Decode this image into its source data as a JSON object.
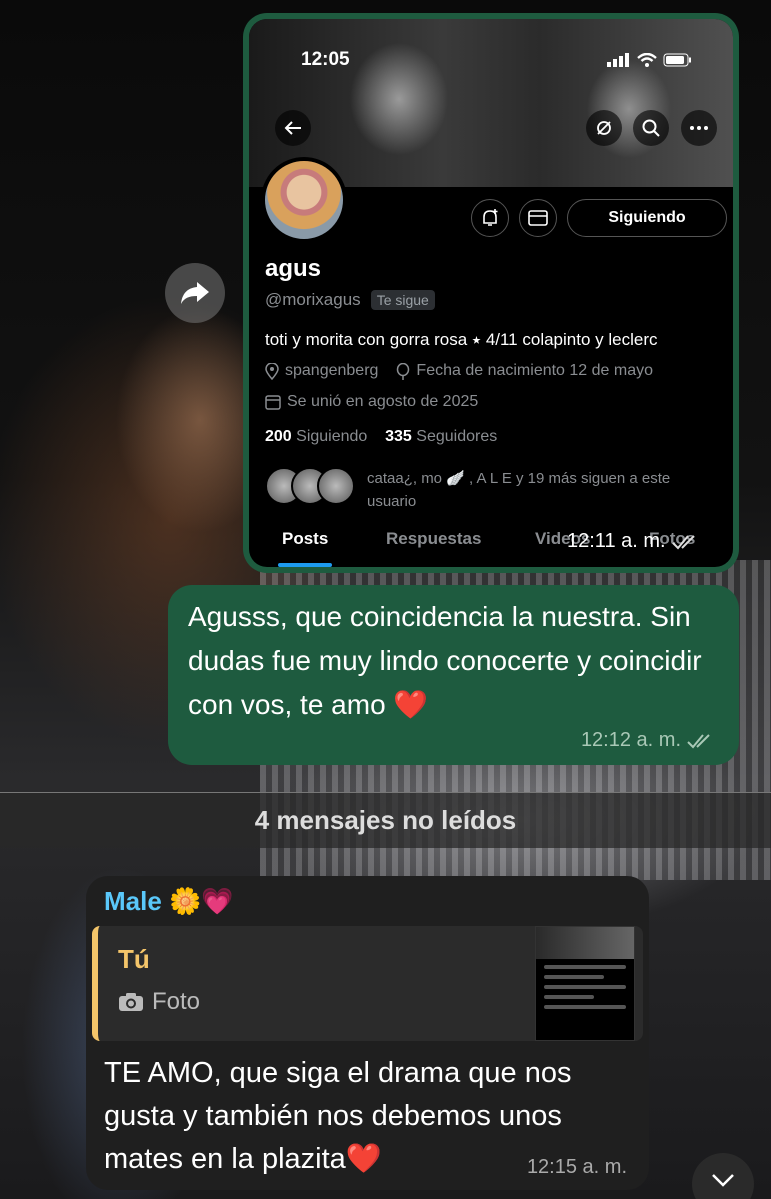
{
  "screenshot": {
    "status_time": "12:05",
    "profile": {
      "name": "agus",
      "handle": "@morixagus",
      "follows_you": "Te sigue",
      "follow_button": "Siguiendo",
      "bio": "toti y morita con gorra rosa ⭑ 4/11 colapinto y leclerc",
      "location": "spangenberg",
      "birthday": "Fecha de nacimiento 12 de mayo",
      "joined": "Se unió en agosto de 2025",
      "following_count": "200",
      "following_label": "Siguiendo",
      "followers_count": "335",
      "followers_label": "Seguidores",
      "followed_by": "cataa¿, mo 🪽 , A L E y 19 más siguen a este usuario"
    },
    "tabs": [
      "Posts",
      "Respuestas",
      "Videos",
      "Fotos"
    ],
    "timestamp": "12:11 a. m."
  },
  "outgoing": {
    "text": "Agusss, que coincidencia la nuestra. Sin dudas fue muy lindo conocerte y coincidir con vos, te amo ❤️",
    "timestamp": "12:12 a. m."
  },
  "unread_divider": "4 mensajes no leídos",
  "incoming": {
    "sender": "Male 🌼💗",
    "reply_to": "Tú",
    "reply_type": "Foto",
    "text": "TE AMO, que siga el drama que nos gusta y también nos debemos unos mates en la plazita❤️",
    "timestamp": "12:15 a. m."
  },
  "colors": {
    "bubble_out": "#1e5b3f",
    "bubble_in": "#1f1f1f",
    "sender": "#5ac8fa",
    "reply_accent": "#f4c56a"
  }
}
